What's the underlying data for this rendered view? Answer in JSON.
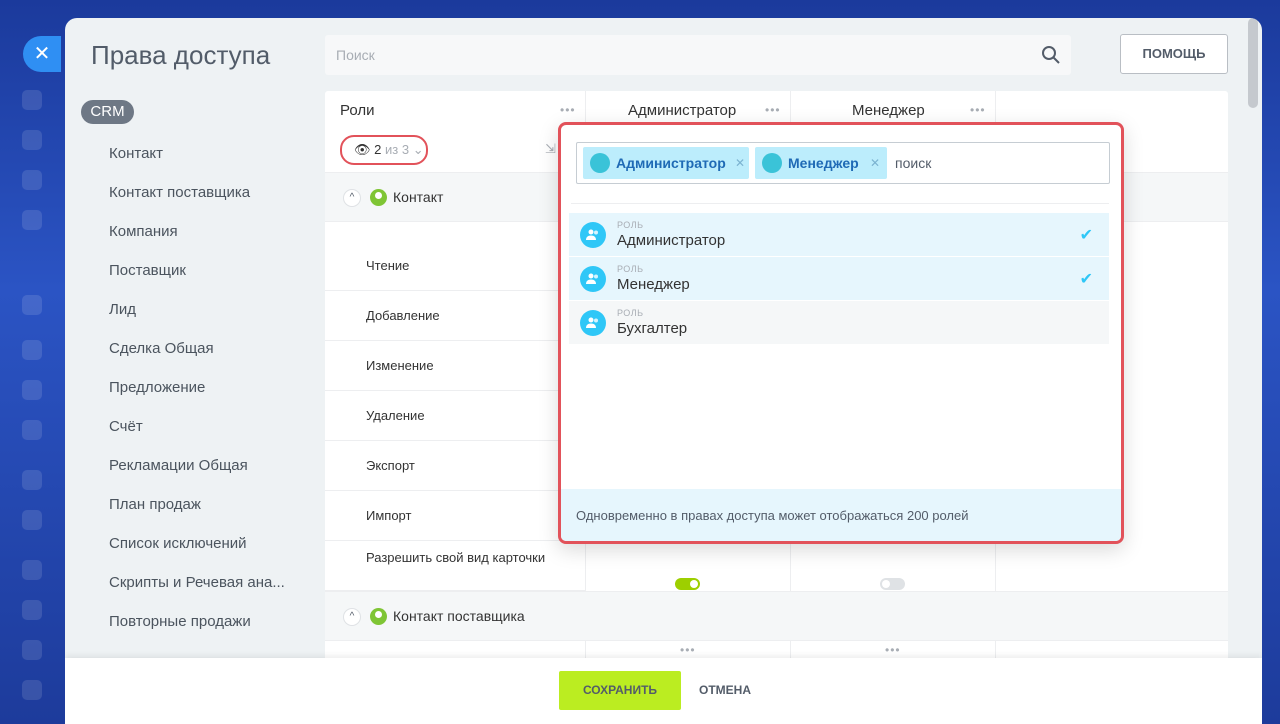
{
  "app": {
    "title": "Права доступа",
    "search_placeholder": "Поиск",
    "help_label": "ПОМОЩЬ",
    "close_icon": "close-icon"
  },
  "sidebar": {
    "badge": "CRM",
    "items": [
      {
        "label": "Контакт"
      },
      {
        "label": "Контакт поставщика"
      },
      {
        "label": "Компания"
      },
      {
        "label": "Поставщик"
      },
      {
        "label": "Лид"
      },
      {
        "label": "Сделка Общая"
      },
      {
        "label": "Предложение"
      },
      {
        "label": "Счёт"
      },
      {
        "label": "Рекламации Общая"
      },
      {
        "label": "План продаж"
      },
      {
        "label": "Список исключений"
      },
      {
        "label": "Скрипты и Речевая ана..."
      },
      {
        "label": "Повторные продажи"
      }
    ]
  },
  "table": {
    "roles_header": "Роли",
    "columns": [
      "Администратор",
      "Менеджер"
    ],
    "filter": {
      "shown": "2",
      "of_text": "из 3"
    },
    "sections": [
      {
        "label": "Контакт",
        "rows": [
          "Чтение",
          "Добавление",
          "Изменение",
          "Удаление",
          "Экспорт",
          "Импорт",
          "Разрешить свой вид карточки"
        ]
      },
      {
        "label": "Контакт поставщика"
      }
    ],
    "card_view_toggles": {
      "admin": true,
      "manager": false
    }
  },
  "popup": {
    "tags": [
      "Администратор",
      "Менеджер"
    ],
    "search_text": "поиск",
    "items": [
      {
        "caption": "РОЛЬ",
        "name": "Администратор",
        "selected": true
      },
      {
        "caption": "РОЛЬ",
        "name": "Менеджер",
        "selected": true
      },
      {
        "caption": "РОЛЬ",
        "name": "Бухгалтер",
        "selected": false
      }
    ],
    "footer_text": "Одновременно в правах доступа может отображаться 200 ролей"
  },
  "footer": {
    "save_label": "СОХРАНИТЬ",
    "cancel_label": "ОТМЕНА"
  },
  "colors": {
    "accent_green": "#bbed21",
    "highlight_red": "#e2525a",
    "tag_bg": "#bcedfc",
    "toggle_on": "#9dcf00"
  }
}
